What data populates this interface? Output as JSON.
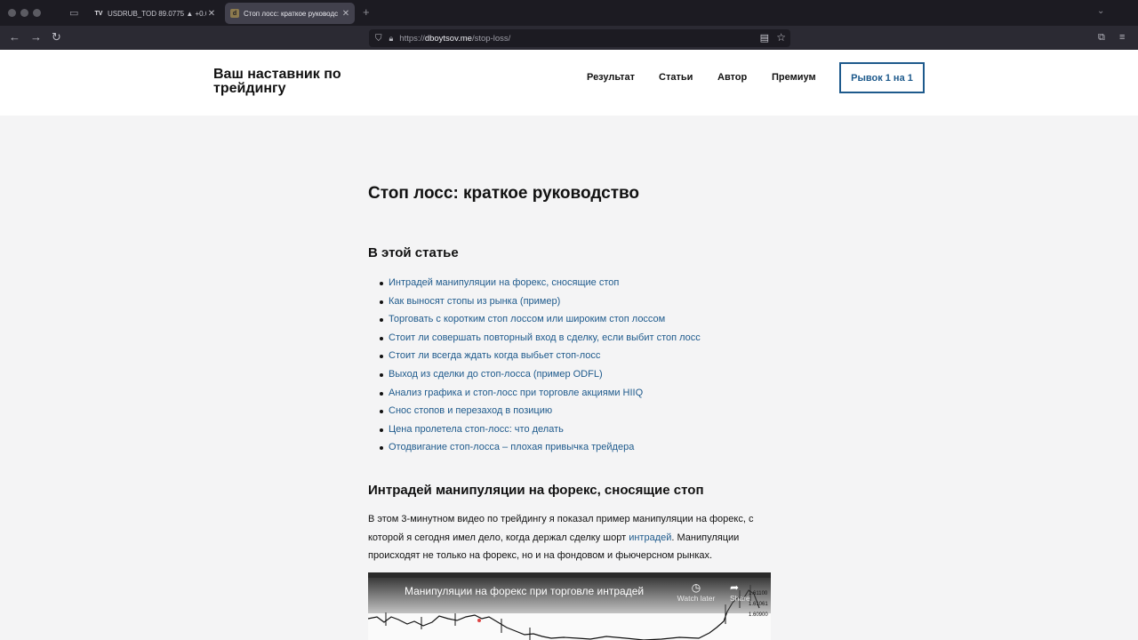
{
  "browser": {
    "tabs": [
      {
        "title": "USDRUB_TOD 89.0775 ▲ +0.0",
        "favicon": "TV",
        "active": false
      },
      {
        "title": "Стоп лосс: краткое руководс",
        "favicon": "d",
        "active": true
      }
    ],
    "url": {
      "prefix": "https://",
      "domain": "dboytsov.me",
      "path": "/stop-loss/"
    }
  },
  "site": {
    "title": "Ваш наставник по трейдингу",
    "nav": [
      "Результат",
      "Статьи",
      "Автор",
      "Премиум"
    ],
    "cta": "Рывок 1 на 1"
  },
  "article": {
    "title": "Стоп лосс: краткое руководство",
    "toc_heading": "В этой статье",
    "toc": [
      "Интрадей манипуляции на форекс, сносящие стоп",
      "Как выносят стопы из рынка (пример)",
      "Торговать с коротким стоп лоссом или широким стоп лоссом",
      "Стоит ли совершать повторный вход в сделку, если выбит стоп лосс",
      "Стоит ли всегда ждать когда выбьет стоп-лосс",
      "Выход из сделки до стоп-лосса (пример ODFL)",
      "Анализ графика и стоп-лосс при торговле акциями HIIQ",
      "Снос стопов и перезаход в позицию",
      "Цена пролетела стоп-лосс: что делать",
      "Отодвигание стоп-лосса – плохая привычка трейдера"
    ],
    "section_heading": "Интрадей манипуляции на форекс, сносящие стоп",
    "paragraph": {
      "before_link": "В этом 3-минутном видео по трейдингу я показал пример манипуляции на форекс, с которой я сегодня имел дело, когда держал сделку шорт ",
      "link": "интрадей",
      "after_link": ". Манипуляции происходят не только на форекс, но и на фондовом и фьючерсном рынках."
    },
    "video": {
      "title": "Манипуляции на форекс при торговле интрадей",
      "watch_later": "Watch later",
      "share": "Share",
      "price_labels": [
        "1.61100",
        "1.61061",
        "1.60900"
      ]
    }
  },
  "colors": {
    "link": "#1e5a8c",
    "chrome": "#1c1b22",
    "toolbar": "#2b2a33",
    "page_bg": "#f4f4f5"
  }
}
